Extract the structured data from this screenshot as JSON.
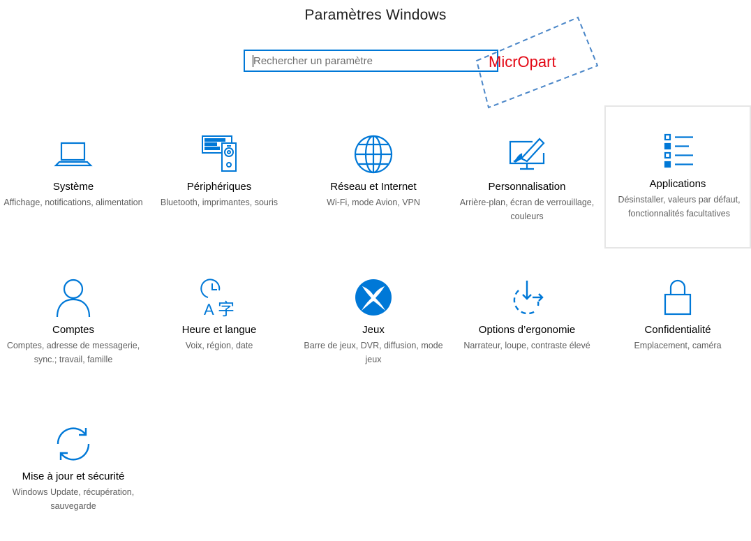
{
  "header": {
    "title": "Paramètres Windows"
  },
  "search": {
    "placeholder": "Rechercher un paramètre",
    "value": ""
  },
  "watermark": {
    "text": "MicrOpart"
  },
  "colors": {
    "accent": "#0078d7",
    "watermark": "#e30613",
    "selected_border": "#e6e6e6"
  },
  "tiles": [
    {
      "name": "Système",
      "desc": "Affichage, notifications, alimentation",
      "icon": "laptop-icon"
    },
    {
      "name": "Périphériques",
      "desc": "Bluetooth, imprimantes, souris",
      "icon": "devices-icon"
    },
    {
      "name": "Réseau et Internet",
      "desc": "Wi-Fi, mode Avion, VPN",
      "icon": "globe-icon"
    },
    {
      "name": "Personnalisation",
      "desc": "Arrière-plan, écran de verrouillage, couleurs",
      "icon": "personalization-icon"
    },
    {
      "name": "Applications",
      "desc": "Désinstaller, valeurs par défaut, fonctionnalités facultatives",
      "icon": "apps-list-icon",
      "selected": true
    },
    {
      "name": "Comptes",
      "desc": "Comptes, adresse de messagerie, sync.; travail, famille",
      "icon": "person-icon"
    },
    {
      "name": "Heure et langue",
      "desc": "Voix, région, date",
      "icon": "time-language-icon"
    },
    {
      "name": "Jeux",
      "desc": "Barre de jeux, DVR, diffusion, mode jeux",
      "icon": "xbox-icon"
    },
    {
      "name": "Options d’ergonomie",
      "desc": "Narrateur, loupe, contraste élevé",
      "icon": "ease-of-access-icon"
    },
    {
      "name": "Confidentialité",
      "desc": "Emplacement, caméra",
      "icon": "lock-icon"
    },
    {
      "name": "Mise à jour et sécurité",
      "desc": "Windows Update, récupération, sauvegarde",
      "icon": "sync-icon"
    }
  ]
}
